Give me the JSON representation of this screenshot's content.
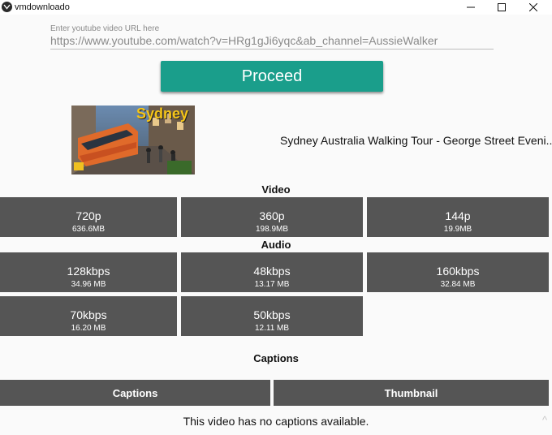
{
  "window": {
    "title": "vmdownloado"
  },
  "url_field": {
    "label": "Enter youtube video URL here",
    "value": "https://www.youtube.com/watch?v=HRg1gJi6yqc&ab_channel=AussieWalker"
  },
  "proceed_label": "Proceed",
  "video": {
    "title": "Sydney Australia Walking Tour - George Street Eveni...",
    "thumbnail_text": "Sydney"
  },
  "sections": {
    "video": "Video",
    "audio": "Audio",
    "captions": "Captions"
  },
  "video_options": [
    {
      "quality": "720p",
      "size": "636.6MB"
    },
    {
      "quality": "360p",
      "size": "198.9MB"
    },
    {
      "quality": "144p",
      "size": "19.9MB"
    }
  ],
  "audio_options": [
    {
      "quality": "128kbps",
      "size": "34.96 MB"
    },
    {
      "quality": "48kbps",
      "size": "13.17 MB"
    },
    {
      "quality": "160kbps",
      "size": "32.84 MB"
    },
    {
      "quality": "70kbps",
      "size": "16.20 MB"
    },
    {
      "quality": "50kbps",
      "size": "12.11 MB"
    }
  ],
  "buttons": {
    "captions": "Captions",
    "thumbnail": "Thumbnail"
  },
  "captions_status": "This video has no captions available.",
  "colors": {
    "accent": "#1a9e8b",
    "tile": "#555555"
  }
}
